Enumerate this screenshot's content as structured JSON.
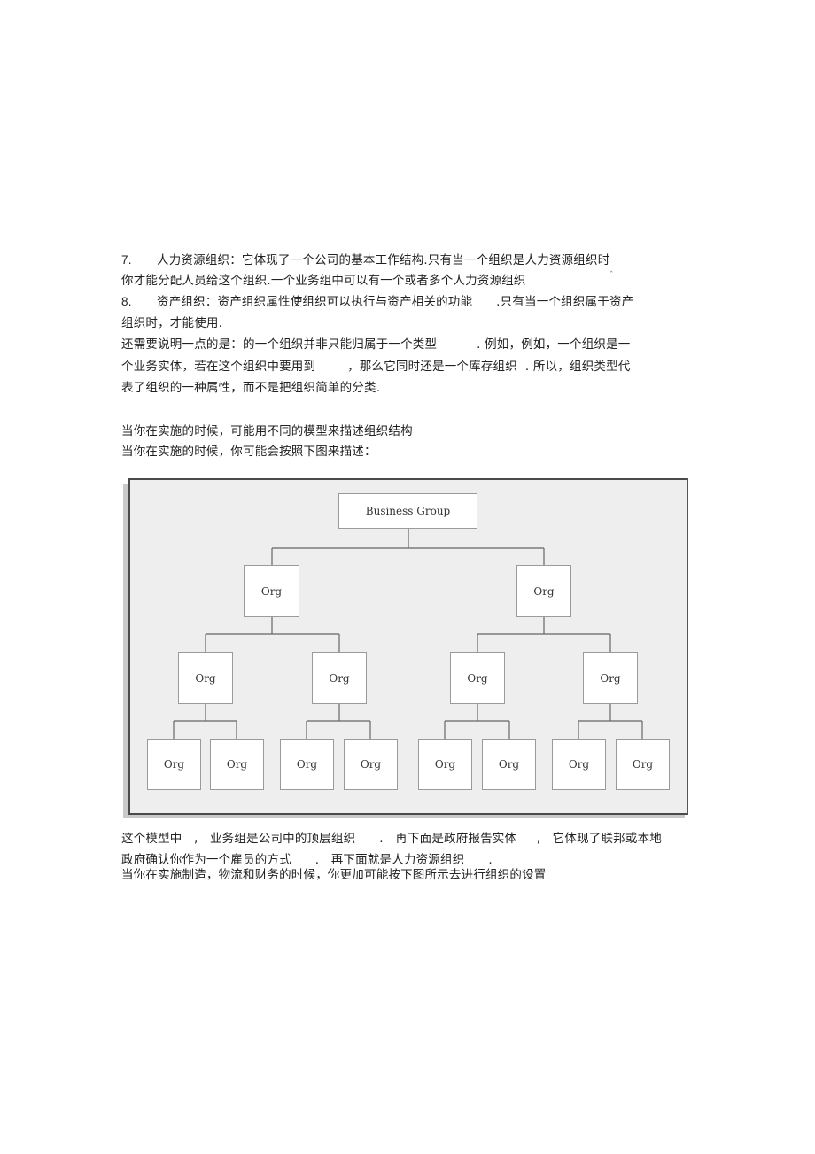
{
  "paragraphs": [
    {
      "number": "7.",
      "text": "人力资源组织：它体现了一个公司的基本工作结构.只有当一个组织是人力资源组织时"
    },
    {
      "text": "你才能分配人员给这个组织.一个业务组中可以有一个或者多个人力资源组织"
    },
    {
      "number": "8.",
      "text": "资产组织：资产组织属性使组织可以执行与资产相关的功能      .只有当一个组织属于资产"
    },
    {
      "text": "组织时，才能使用."
    },
    {
      "text": "还需要说明一点的是：的一个组织并非只能归属于一个类型          . 例如，例如，一个组织是一"
    },
    {
      "text": "个业务实体，若在这个组织中要用到        ，那么它同时还是一个库存组织  . 所以，组织类型代"
    },
    {
      "text": "表了组织的一种属性，而不是把组织简单的分类."
    },
    {
      "text": "当你在实施的时候，可能用不同的模型来描述组织结构"
    },
    {
      "text": "当你在实施的时候，你可能会按照下图来描述："
    },
    {
      "text": "这个模型中   ,   业务组是公司中的顶层组织      .   再下面是政府报告实体     ,   它体现了联邦或本地"
    },
    {
      "text": "政府确认你作为一个雇员的方式      .   再下面就是人力资源组织      ."
    },
    {
      "text": "当你在实施制造，物流和财务的时候，你更加可能按下图所示去进行组织的设置"
    }
  ],
  "caret_mark": "ˆ",
  "diagram": {
    "root": "Business Group",
    "level1": [
      "Org",
      "Org"
    ],
    "level2": [
      "Org",
      "Org",
      "Org",
      "Org"
    ],
    "leaves": [
      "Org",
      "Org",
      "Org",
      "Org",
      "Org",
      "Org",
      "Org",
      "Org"
    ],
    "colors": {
      "frame_bg": "#eeeeee",
      "frame_border": "#4a4a4a",
      "node_bg": "#ffffff",
      "connector": "#666666"
    }
  }
}
